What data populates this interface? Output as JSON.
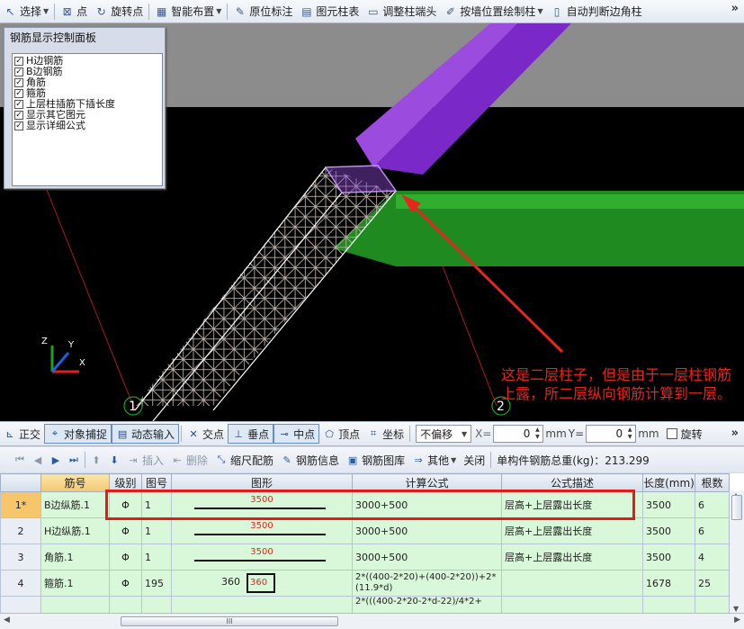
{
  "top_toolbar": {
    "items": [
      {
        "label": "选择",
        "icon": "select-arrow-icon",
        "dropdown": true
      },
      {
        "label": "点",
        "icon": "point-icon"
      },
      {
        "label": "旋转点",
        "icon": "rotate-point-icon"
      },
      {
        "label": "智能布置",
        "icon": "smart-layout-icon",
        "dropdown": true
      },
      {
        "label": "原位标注",
        "icon": "in-place-annotation-icon"
      },
      {
        "label": "图元柱表",
        "icon": "column-table-icon"
      },
      {
        "label": "调整柱端头",
        "icon": "adjust-column-end-icon"
      },
      {
        "label": "按墙位置绘制柱",
        "icon": "draw-by-wall-icon",
        "dropdown": true
      },
      {
        "label": "自动判断边角柱",
        "icon": "auto-corner-column-icon"
      }
    ],
    "more": "»"
  },
  "rebar_panel": {
    "title": "钢筋显示控制面板",
    "items": [
      {
        "label": "H边钢筋",
        "checked": true
      },
      {
        "label": "B边钢筋",
        "checked": true
      },
      {
        "label": "角筋",
        "checked": true
      },
      {
        "label": "箍筋",
        "checked": true
      },
      {
        "label": "上层柱插筋下插长度",
        "checked": true
      },
      {
        "label": "显示其它图元",
        "checked": true
      },
      {
        "label": "显示详细公式",
        "checked": true
      }
    ]
  },
  "viewport": {
    "axis_labels": {
      "x": "X",
      "y": "Y",
      "z": "Z"
    },
    "grid_markers": [
      "1",
      "2"
    ],
    "annotation": "这是二层柱子，但是由于一层柱钢筋上露，所二层纵向钢筋计算到一层。",
    "colors": {
      "upper_column": "#7b28c8",
      "beam": "#1f8a1f",
      "gray_band": "#8c8c8c",
      "annotation": "#e8251e"
    }
  },
  "snap_toolbar": {
    "ortho": "正交",
    "object_snap": "对象捕捉",
    "dynamic_input": "动态输入",
    "intersection": "交点",
    "perpendicular": "垂点",
    "midpoint": "中点",
    "vertex": "顶点",
    "coordinate": "坐标",
    "offset_select": "不偏移",
    "x_label": "X=",
    "x_value": "0",
    "y_label": "Y=",
    "y_value": "0",
    "unit": "mm",
    "rotate": "旋转",
    "more": "»"
  },
  "table_toolbar": {
    "insert": "插入",
    "delete": "删除",
    "scale_rebar": "缩尺配筋",
    "rebar_info": "钢筋信息",
    "rebar_library": "钢筋图库",
    "other": "其他",
    "close": "关闭",
    "total_weight": "单构件钢筋总重(kg)：213.299"
  },
  "table": {
    "headers": [
      "筋号",
      "级别",
      "图号",
      "图形",
      "计算公式",
      "公式描述",
      "长度(mm)",
      "根数"
    ],
    "rows": [
      {
        "num": "1*",
        "name": "B边纵筋.1",
        "grade": "Φ",
        "fig": "1",
        "shape": "3500",
        "formula": "3000+500",
        "desc": "层高+上层露出长度",
        "length": "3500",
        "count": "6",
        "selected": true
      },
      {
        "num": "2",
        "name": "H边纵筋.1",
        "grade": "Φ",
        "fig": "1",
        "shape": "3500",
        "formula": "3000+500",
        "desc": "层高+上层露出长度",
        "length": "3500",
        "count": "6"
      },
      {
        "num": "3",
        "name": "角筋.1",
        "grade": "Φ",
        "fig": "1",
        "shape": "3500",
        "formula": "3000+500",
        "desc": "层高+上层露出长度",
        "length": "3500",
        "count": "4"
      },
      {
        "num": "4",
        "name": "箍筋.1",
        "grade": "Φ",
        "fig": "195",
        "shape_outer": "360",
        "shape_inner": "360",
        "formula": "2*((400-2*20)+(400-2*20))+2*(11.9*d)",
        "desc": "",
        "length": "1678",
        "count": "25"
      },
      {
        "num": "",
        "name": "",
        "grade": "",
        "fig": "",
        "shape": "",
        "formula": "2*(((400-2*20-2*d-22)/4*2+",
        "desc": "",
        "length": "",
        "count": ""
      }
    ]
  },
  "hscroll_grip": "III"
}
